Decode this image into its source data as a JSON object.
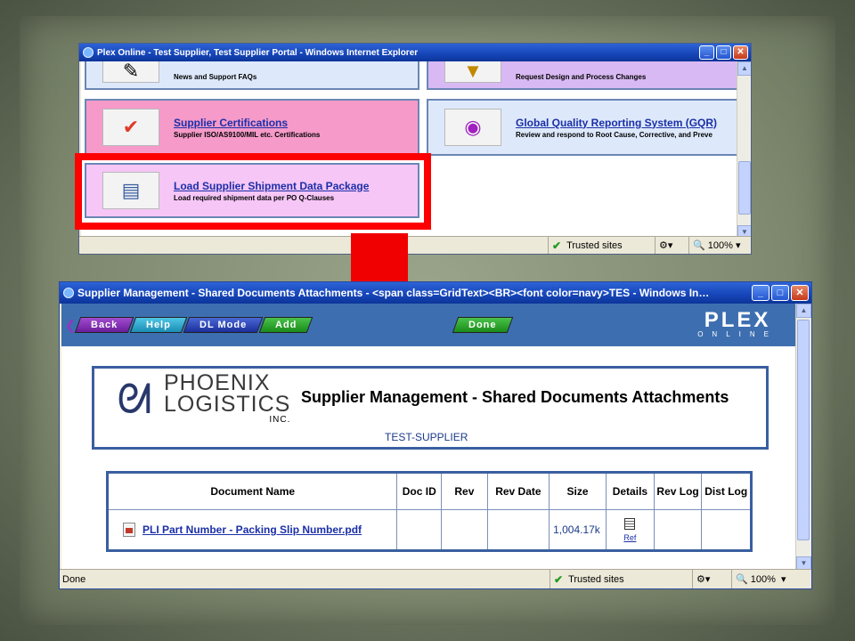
{
  "window1": {
    "title": "Plex Online - Test Supplier, Test Supplier Portal - Windows Internet Explorer",
    "tiles": [
      {
        "title": "",
        "subtitle": "News and Support FAQs",
        "icon": "document-icon"
      },
      {
        "title": "",
        "subtitle": "Request Design and Process Changes",
        "icon": "pin-icon"
      },
      {
        "title": "Supplier Certifications",
        "subtitle": "Supplier ISO/AS9100/MIL etc. Certifications",
        "icon": "certificate-icon"
      },
      {
        "title": "Global Quality Reporting System (GQR)",
        "subtitle": "Review and respond to Root Cause, Corrective, and Preve",
        "icon": "globe-icon"
      },
      {
        "title": "Load Supplier Shipment Data Package",
        "subtitle": "Load required shipment data per PO Q-Clauses",
        "icon": "document-icon"
      }
    ],
    "status": {
      "zone": "Trusted sites",
      "zoom": "100%"
    }
  },
  "window2": {
    "title": "Supplier Management - Shared Documents Attachments - <span class=GridText><BR><font color=navy>TES - Windows In…",
    "toolbar": {
      "back": "Back",
      "help": "Help",
      "dl_mode": "DL Mode",
      "add": "Add",
      "done": "Done"
    },
    "logo": {
      "big": "PLEX",
      "small": "ONLINE"
    },
    "company": {
      "line1": "PHOENIX",
      "line2": "LOGISTICS",
      "line3": "INC."
    },
    "heading": "Supplier Management - Shared Documents Attachments",
    "supplier": "TEST-SUPPLIER",
    "table": {
      "headers": [
        "Document Name",
        "Doc ID",
        "Rev",
        "Rev Date",
        "Size",
        "Details",
        "Rev Log",
        "Dist Log"
      ],
      "row": {
        "name": "PLI Part Number - Packing Slip Number.pdf",
        "doc_id": "",
        "rev": "",
        "rev_date": "",
        "size": "1,004.17k",
        "details": "Ref",
        "rev_log": "",
        "dist_log": ""
      }
    },
    "status": {
      "left": "Done",
      "zone": "Trusted sites",
      "zoom": "100%"
    }
  },
  "colors": {
    "highlight": "#ff0000",
    "accent": "#3d6fb0",
    "link": "#1b2fa8"
  }
}
